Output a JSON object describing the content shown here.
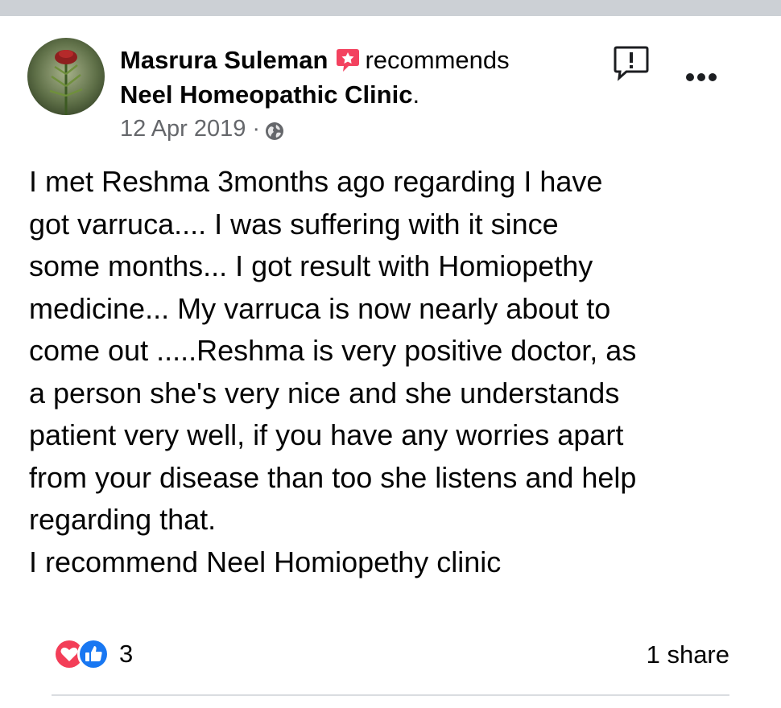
{
  "post": {
    "author": "Masrura Suleman",
    "action": "recommends",
    "page_name": "Neel Homeopathic Clinic",
    "page_name_suffix": ".",
    "date": "12 Apr 2019",
    "separator": "·",
    "privacy_icon": "globe-icon",
    "body_lines": [
      "I met Reshma 3months ago regarding I have",
      "got varruca.... I  was suffering with it since",
      "some months... I got result with Homiopethy",
      "medicine... My varruca is now nearly about to",
      "come out .....Reshma is very positive doctor, as",
      "a person she's very nice and she understands",
      "patient very well, if you have any worries apart",
      "from your disease than too she listens and help",
      "regarding that.",
      "I recommend Neel Homiopethy clinic"
    ],
    "reaction_count": "3",
    "share_text": "1 share"
  },
  "icons": {
    "recommend": "recommend-badge-icon",
    "report": "report-icon",
    "more": "more-options-icon",
    "love": "love-reaction-icon",
    "like": "like-reaction-icon"
  },
  "colors": {
    "recommend_red": "#f3425f",
    "like_blue": "#1877f2",
    "love_red": "#f33e58",
    "secondary_text": "#65676b",
    "top_bar": "#ccd0d5"
  }
}
